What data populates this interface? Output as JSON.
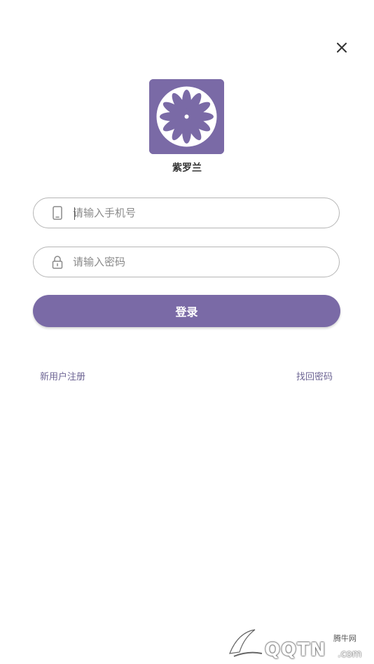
{
  "app": {
    "name": "紫罗兰"
  },
  "form": {
    "phone_placeholder": "请输入手机号",
    "password_placeholder": "请输入密码",
    "login_label": "登录"
  },
  "links": {
    "register": "新用户注册",
    "forgot": "找回密码"
  },
  "watermark": {
    "site_cn": "腾牛网",
    "brand": "QQTN",
    "domain": ".com"
  },
  "icons": {
    "close": "close-icon",
    "phone": "phone-icon",
    "lock": "lock-icon",
    "logo": "flower-logo-icon"
  },
  "colors": {
    "accent": "#7a6aa6",
    "link": "#6d6594",
    "border": "#b5b5b5"
  }
}
